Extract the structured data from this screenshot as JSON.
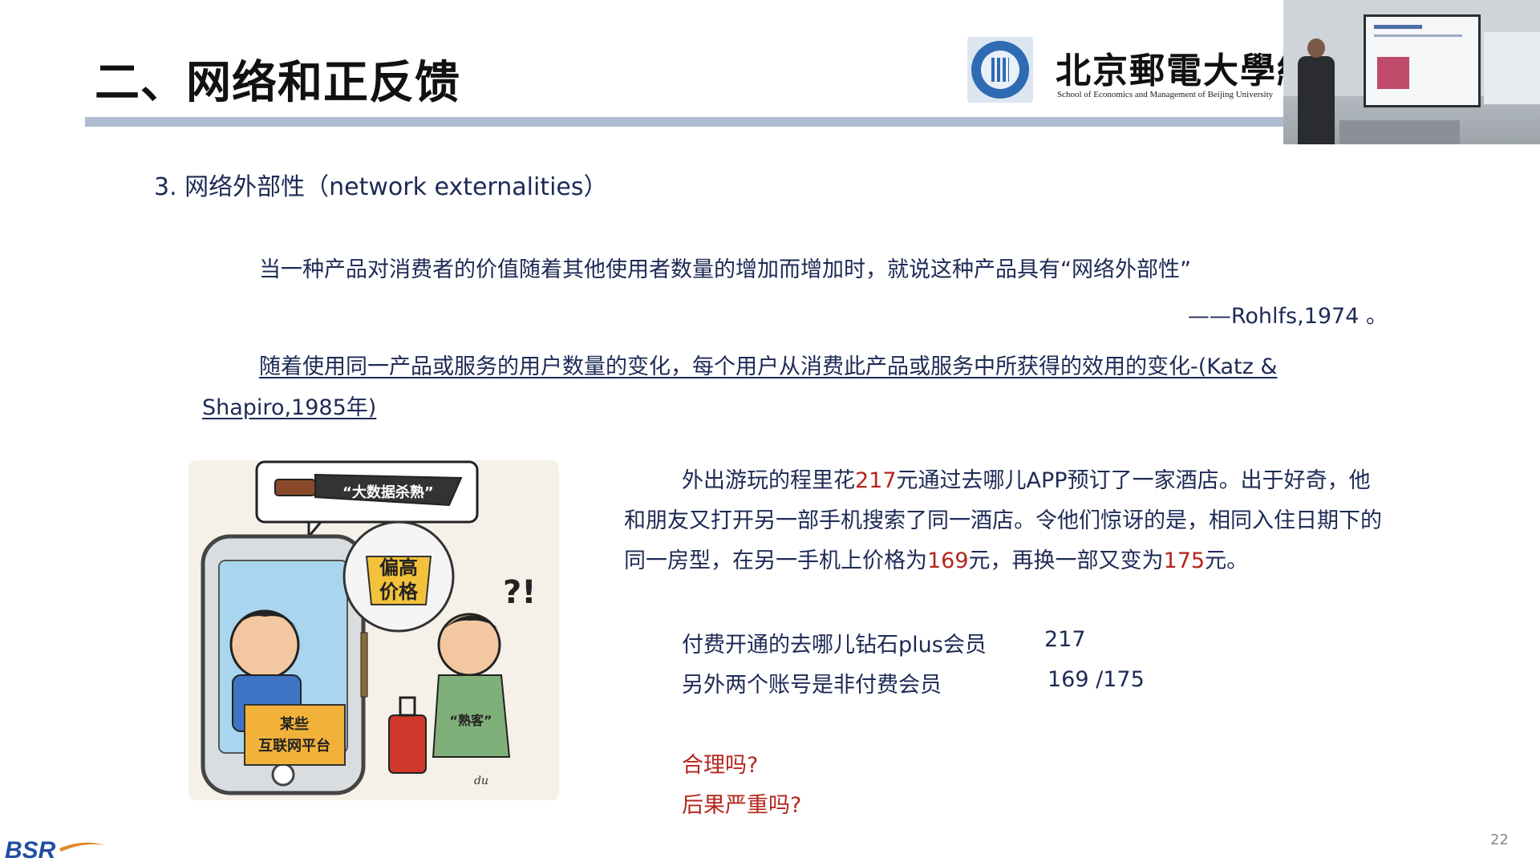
{
  "slide": {
    "title": "二、网络和正反馈",
    "subtitle": "3. 网络外部性（network externalities）",
    "definition": "当一种产品对消费者的价值随着其他使用者数量的增加而增加时，就说这种产品具有“网络外部性”",
    "citation": "——Rohlfs,1974 。",
    "definition2": "随着使用同一产品或服务的用户数量的变化，每个用户从消费此产品或服务中所获得的效用的变化-(Katz & Shapiro,1985年)",
    "case": {
      "t1": "外出游玩的程里花",
      "v1": "217",
      "t2": "元通过去哪儿APP预订了一家酒店。出于好奇，他和朋友又打开另一部手机搜索了同一酒店。令他们惊讶的是，相同入住日期下的同一房型，在另一手机上价格为",
      "v2": "169",
      "t3": "元，再换一部又变为",
      "v3": "175",
      "t4": "元。"
    },
    "stats": [
      {
        "label": "付费开通的去哪儿钻石plus会员",
        "value": "217"
      },
      {
        "label": "另外两个账号是非付费会员",
        "value": "169 /175"
      }
    ],
    "questions": [
      "合理吗?",
      "后果严重吗?"
    ],
    "page_number": "22"
  },
  "logo": {
    "university_cn": "北京郵電大學經濟",
    "university_en": "School of Economics and Management of Beijing University"
  },
  "cartoon": {
    "knife_text": "“大数据杀熟”",
    "sign_line1": "偏高",
    "sign_line2": "价格",
    "platform_line1": "某些",
    "platform_line2": "互联网平台",
    "customer_tag": "“熟客”",
    "exclaim": "?!",
    "signature": "du"
  },
  "footer": {
    "brand": "BSR"
  },
  "colors": {
    "text": "#1d2a55",
    "highlight": "#b3261e",
    "title_rule": "#aebbd0",
    "brand_blue": "#1f4fa3"
  },
  "icons": [
    "university-seal-icon",
    "bsr-logo-icon",
    "knife-icon",
    "suitcase-icon"
  ]
}
